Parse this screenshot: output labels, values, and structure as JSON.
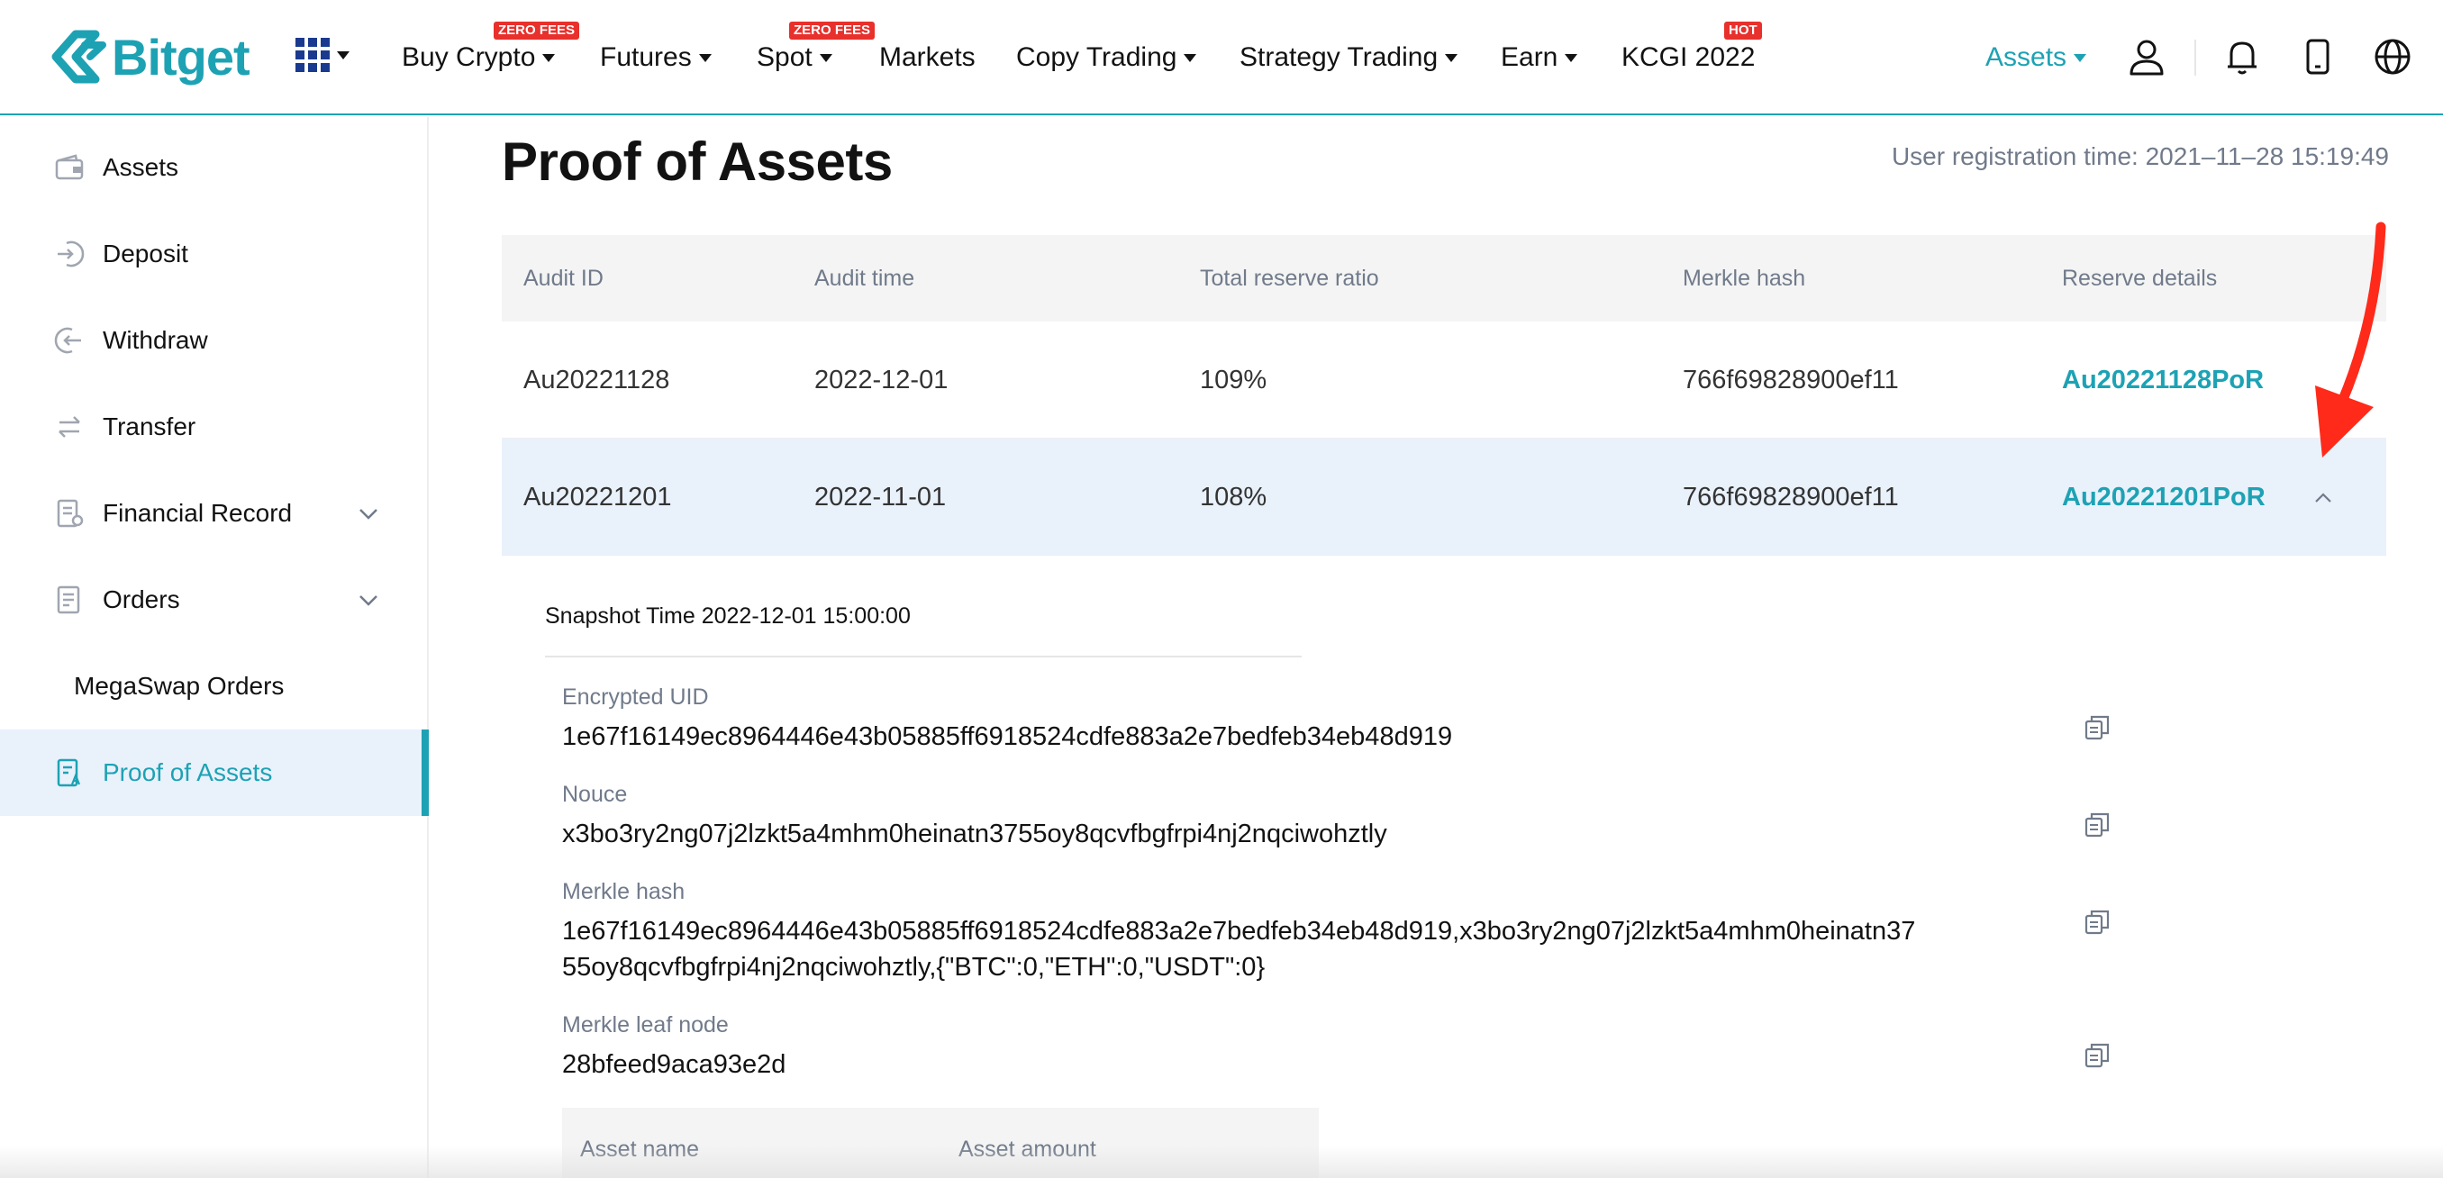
{
  "header": {
    "brand": "Bitget",
    "nav": [
      {
        "label": "Buy Crypto",
        "badge": "ZERO FEES"
      },
      {
        "label": "Futures"
      },
      {
        "label": "Spot",
        "badge": "ZERO FEES"
      },
      {
        "label": "Markets"
      },
      {
        "label": "Copy Trading"
      },
      {
        "label": "Strategy Trading"
      },
      {
        "label": "Earn"
      },
      {
        "label": "KCGI 2022",
        "badge": "HOT"
      }
    ],
    "assets_label": "Assets",
    "icons": [
      "user-icon",
      "bell-icon",
      "phone-icon",
      "globe-icon"
    ],
    "accent_color": "#1da2b4"
  },
  "sidebar": {
    "items": [
      {
        "label": "Assets",
        "icon": "wallet-icon"
      },
      {
        "label": "Deposit",
        "icon": "deposit-icon"
      },
      {
        "label": "Withdraw",
        "icon": "withdraw-icon"
      },
      {
        "label": "Transfer",
        "icon": "transfer-icon"
      },
      {
        "label": "Financial Record",
        "icon": "record-icon",
        "expandable": true
      },
      {
        "label": "Orders",
        "icon": "orders-icon",
        "expandable": true
      },
      {
        "label": "MegaSwap Orders"
      },
      {
        "label": "Proof of Assets",
        "icon": "proof-icon",
        "active": true
      }
    ]
  },
  "main": {
    "title": "Proof of Assets",
    "registration_time": "User registration time: 2021–11–28 15:19:49",
    "table": {
      "columns": [
        "Audit ID",
        "Audit time",
        "Total reserve ratio",
        "Merkle hash",
        "Reserve details"
      ],
      "rows": [
        {
          "audit_id": "Au20221128",
          "audit_time": "2022-12-01",
          "ratio": "109%",
          "merkle_hash": "766f69828900ef11",
          "details": "Au20221128PoR"
        },
        {
          "audit_id": "Au20221201",
          "audit_time": "2022-11-01",
          "ratio": "108%",
          "merkle_hash": "766f69828900ef11",
          "details": "Au20221201PoR",
          "expanded": true
        }
      ]
    },
    "detail": {
      "snapshot_time": "Snapshot Time 2022-12-01 15:00:00",
      "fields": [
        {
          "label": "Encrypted UID",
          "value": "1e67f16149ec8964446e43b05885ff6918524cdfe883a2e7bedfeb34eb48d919"
        },
        {
          "label": "Nouce",
          "value": "x3bo3ry2ng07j2lzkt5a4mhm0heinatn3755oy8qcvfbgfrpi4nj2nqciwohztly"
        },
        {
          "label": "Merkle hash",
          "value_line1": "1e67f16149ec8964446e43b05885ff6918524cdfe883a2e7bedfeb34eb48d919,x3bo3ry2ng07j2lzkt5a4mhm0heinatn37",
          "value_line2": "55oy8qcvfbgfrpi4nj2nqciwohztly,{\"BTC\":0,\"ETH\":0,\"USDT\":0}"
        },
        {
          "label": "Merkle leaf node",
          "value": "28bfeed9aca93e2d"
        }
      ],
      "asset_columns": [
        "Asset name",
        "Asset amount"
      ]
    }
  },
  "annotation_color": "#ff2a1a"
}
